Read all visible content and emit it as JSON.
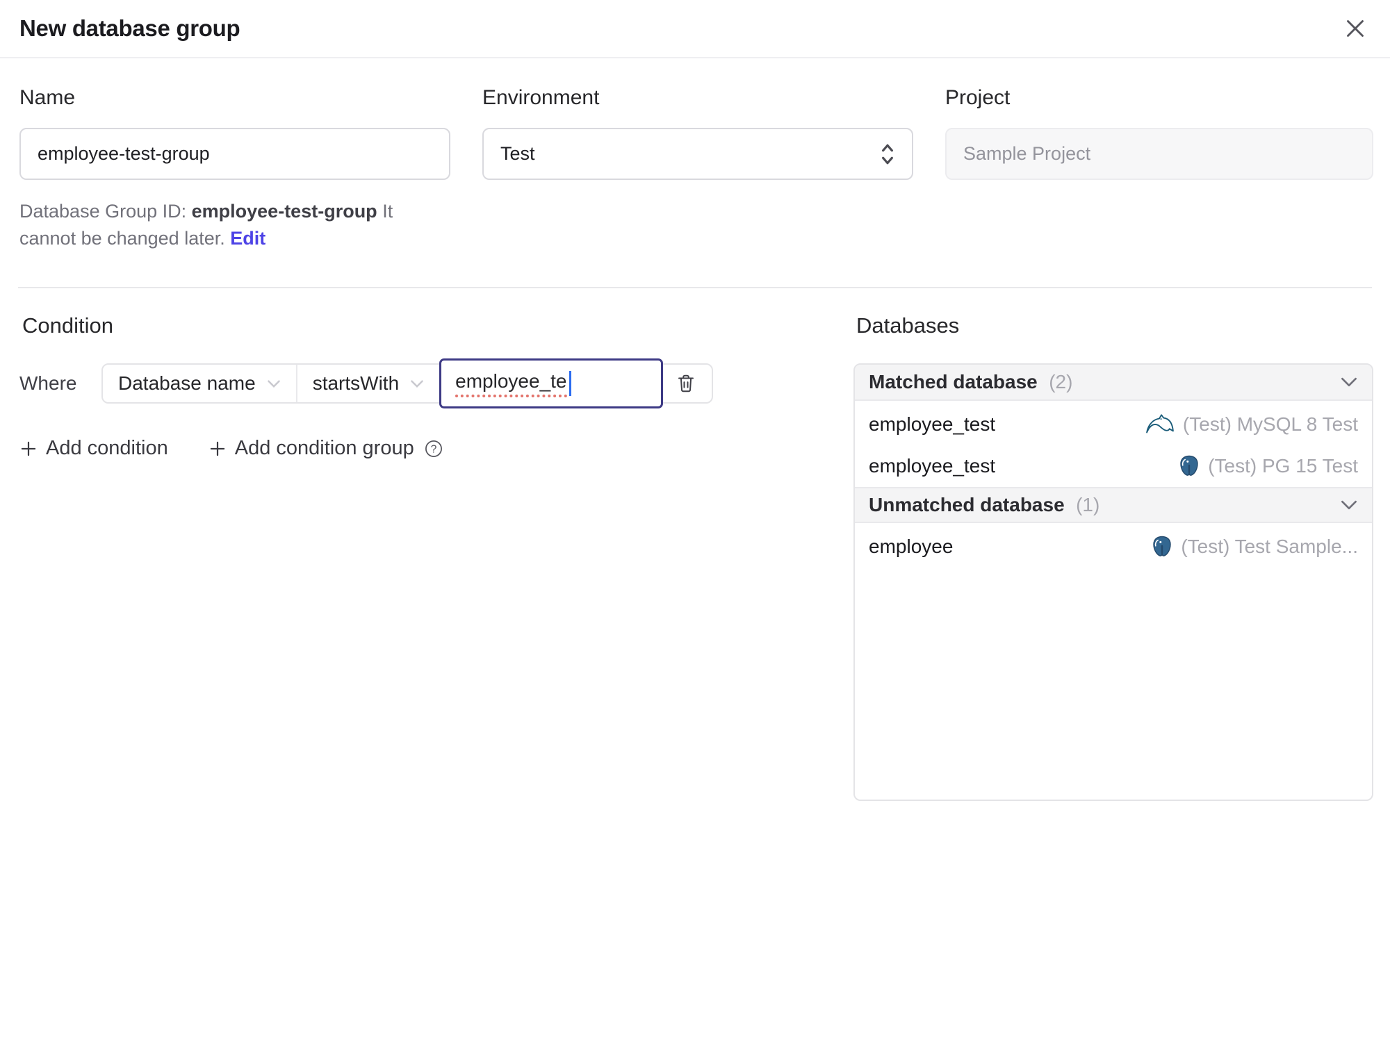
{
  "header": {
    "title": "New database group"
  },
  "form": {
    "name": {
      "label": "Name",
      "value": "employee-test-group"
    },
    "environment": {
      "label": "Environment",
      "value": "Test"
    },
    "project": {
      "label": "Project",
      "value": "Sample Project"
    },
    "help": {
      "prefix": "Database Group ID: ",
      "group_id": "employee-test-group",
      "note": " It cannot be changed later. ",
      "edit": "Edit"
    }
  },
  "condition": {
    "heading": "Condition",
    "where": "Where",
    "field": "Database name",
    "operator": "startsWith",
    "value": "employee_te",
    "add_condition": "Add condition",
    "add_condition_group": "Add condition group"
  },
  "databases": {
    "heading": "Databases",
    "sections": [
      {
        "title": "Matched database",
        "count": "(2)",
        "rows": [
          {
            "name": "employee_test",
            "engine": "mysql-icon",
            "instance": "(Test) MySQL 8 Test"
          },
          {
            "name": "employee_test",
            "engine": "postgres-icon",
            "instance": "(Test) PG 15 Test"
          }
        ]
      },
      {
        "title": "Unmatched database",
        "count": "(1)",
        "rows": [
          {
            "name": "employee",
            "engine": "postgres-icon",
            "instance": "(Test) Test Sample..."
          }
        ]
      }
    ]
  },
  "colors": {
    "accent": "#4d43e6",
    "focus_border": "#3d3a85",
    "mysql": "#1c5d7a",
    "postgres": "#336791",
    "spellcheck": "#e3736b"
  }
}
